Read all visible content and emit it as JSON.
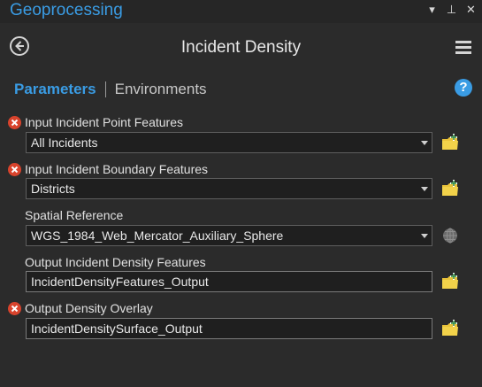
{
  "pane": {
    "title": "Geoprocessing",
    "controls": {
      "dropdown": "▾",
      "pin": "⊥",
      "close": "✕"
    }
  },
  "tool": {
    "title": "Incident Density"
  },
  "tabs": {
    "parameters": "Parameters",
    "environments": "Environments",
    "help": "?"
  },
  "params": [
    {
      "label": "Input Incident Point Features",
      "value": "All Incidents",
      "required_error": true,
      "kind": "dropdown"
    },
    {
      "label": "Input Incident Boundary Features",
      "value": "Districts",
      "required_error": true,
      "kind": "dropdown"
    },
    {
      "label": "Spatial Reference",
      "value": "WGS_1984_Web_Mercator_Auxiliary_Sphere",
      "required_error": false,
      "kind": "dropdown"
    },
    {
      "label": "Output Incident Density Features",
      "value": "IncidentDensityFeatures_Output",
      "required_error": false,
      "kind": "text"
    },
    {
      "label": "Output Density Overlay",
      "value": "IncidentDensitySurface_Output",
      "required_error": true,
      "kind": "text"
    }
  ],
  "colors": {
    "accent": "#3a9ce4",
    "error": "#d8432c",
    "background": "#2b2b2b",
    "folder": "#e8c23a"
  }
}
